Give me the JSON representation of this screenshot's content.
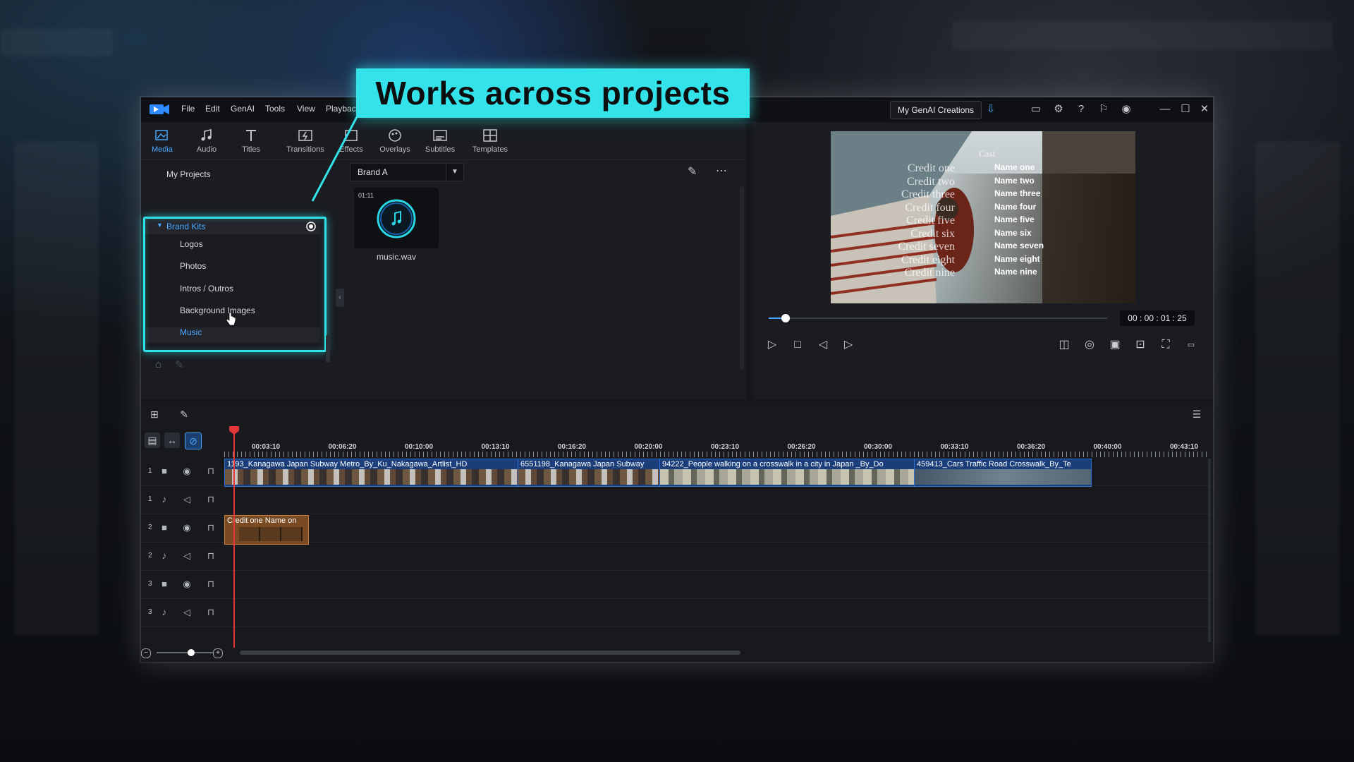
{
  "callout": {
    "text": "Works across projects"
  },
  "menu": [
    "File",
    "Edit",
    "GenAI",
    "Tools",
    "View",
    "Playback"
  ],
  "titlebar": {
    "genai_button": "My GenAI Creations"
  },
  "tabs": [
    {
      "label": "Media",
      "icon": "media-icon",
      "active": true
    },
    {
      "label": "Audio",
      "icon": "music-note-icon"
    },
    {
      "label": "Titles",
      "icon": "titles-icon"
    },
    {
      "label": "Transitions",
      "icon": "transitions-icon"
    },
    {
      "label": "Effects",
      "icon": "effects-icon"
    },
    {
      "label": "Overlays",
      "icon": "overlays-icon"
    },
    {
      "label": "Subtitles",
      "icon": "subtitles-icon"
    },
    {
      "label": "Templates",
      "icon": "templates-icon"
    }
  ],
  "tree": {
    "my_projects": "My Projects",
    "brand_kits": "Brand Kits",
    "items": [
      "Logos",
      "Photos",
      "Intros / Outros",
      "Background Images",
      "Music"
    ]
  },
  "library": {
    "dropdown": "Brand A",
    "media": {
      "duration": "01:11",
      "name": "music.wav"
    }
  },
  "preview": {
    "timecode": "00 : 00 : 01 : 25",
    "progress": 0.05,
    "credits_header": "Cast",
    "credits": [
      {
        "left": "Credit one",
        "right": "Name one"
      },
      {
        "left": "Credit two",
        "right": "Name two"
      },
      {
        "left": "Credit three",
        "right": "Name three"
      },
      {
        "left": "Credit four",
        "right": "Name four"
      },
      {
        "left": "Credit five",
        "right": "Name five"
      },
      {
        "left": "Credit six",
        "right": "Name six"
      },
      {
        "left": "Credit seven",
        "right": "Name seven"
      },
      {
        "left": "Credit eight",
        "right": "Name eight"
      },
      {
        "left": "Credit nine",
        "right": "Name nine"
      }
    ]
  },
  "timeline": {
    "ruler": [
      "00:03:10",
      "00:06:20",
      "00:10:00",
      "00:13:10",
      "00:16:20",
      "00:20:00",
      "00:23:10",
      "00:26:20",
      "00:30:00",
      "00:33:10",
      "00:36:20",
      "00:40:00",
      "00:43:10"
    ],
    "tracks": [
      {
        "num": "1",
        "type": "video"
      },
      {
        "num": "1",
        "type": "audio"
      },
      {
        "num": "2",
        "type": "video"
      },
      {
        "num": "2",
        "type": "audio"
      },
      {
        "num": "3",
        "type": "video"
      },
      {
        "num": "3",
        "type": "audio"
      }
    ],
    "clips": [
      "1193_Kanagawa Japan Subway Metro_By_Ku_Nakagawa_Artlist_HD",
      "6551198_Kanagawa Japan Subway",
      "94222_People walking on a crosswalk in a city in Japan _By_Do",
      "459413_Cars Traffic Road Crosswalk_By_Te"
    ],
    "title_clip": "Credit one   Name on"
  }
}
